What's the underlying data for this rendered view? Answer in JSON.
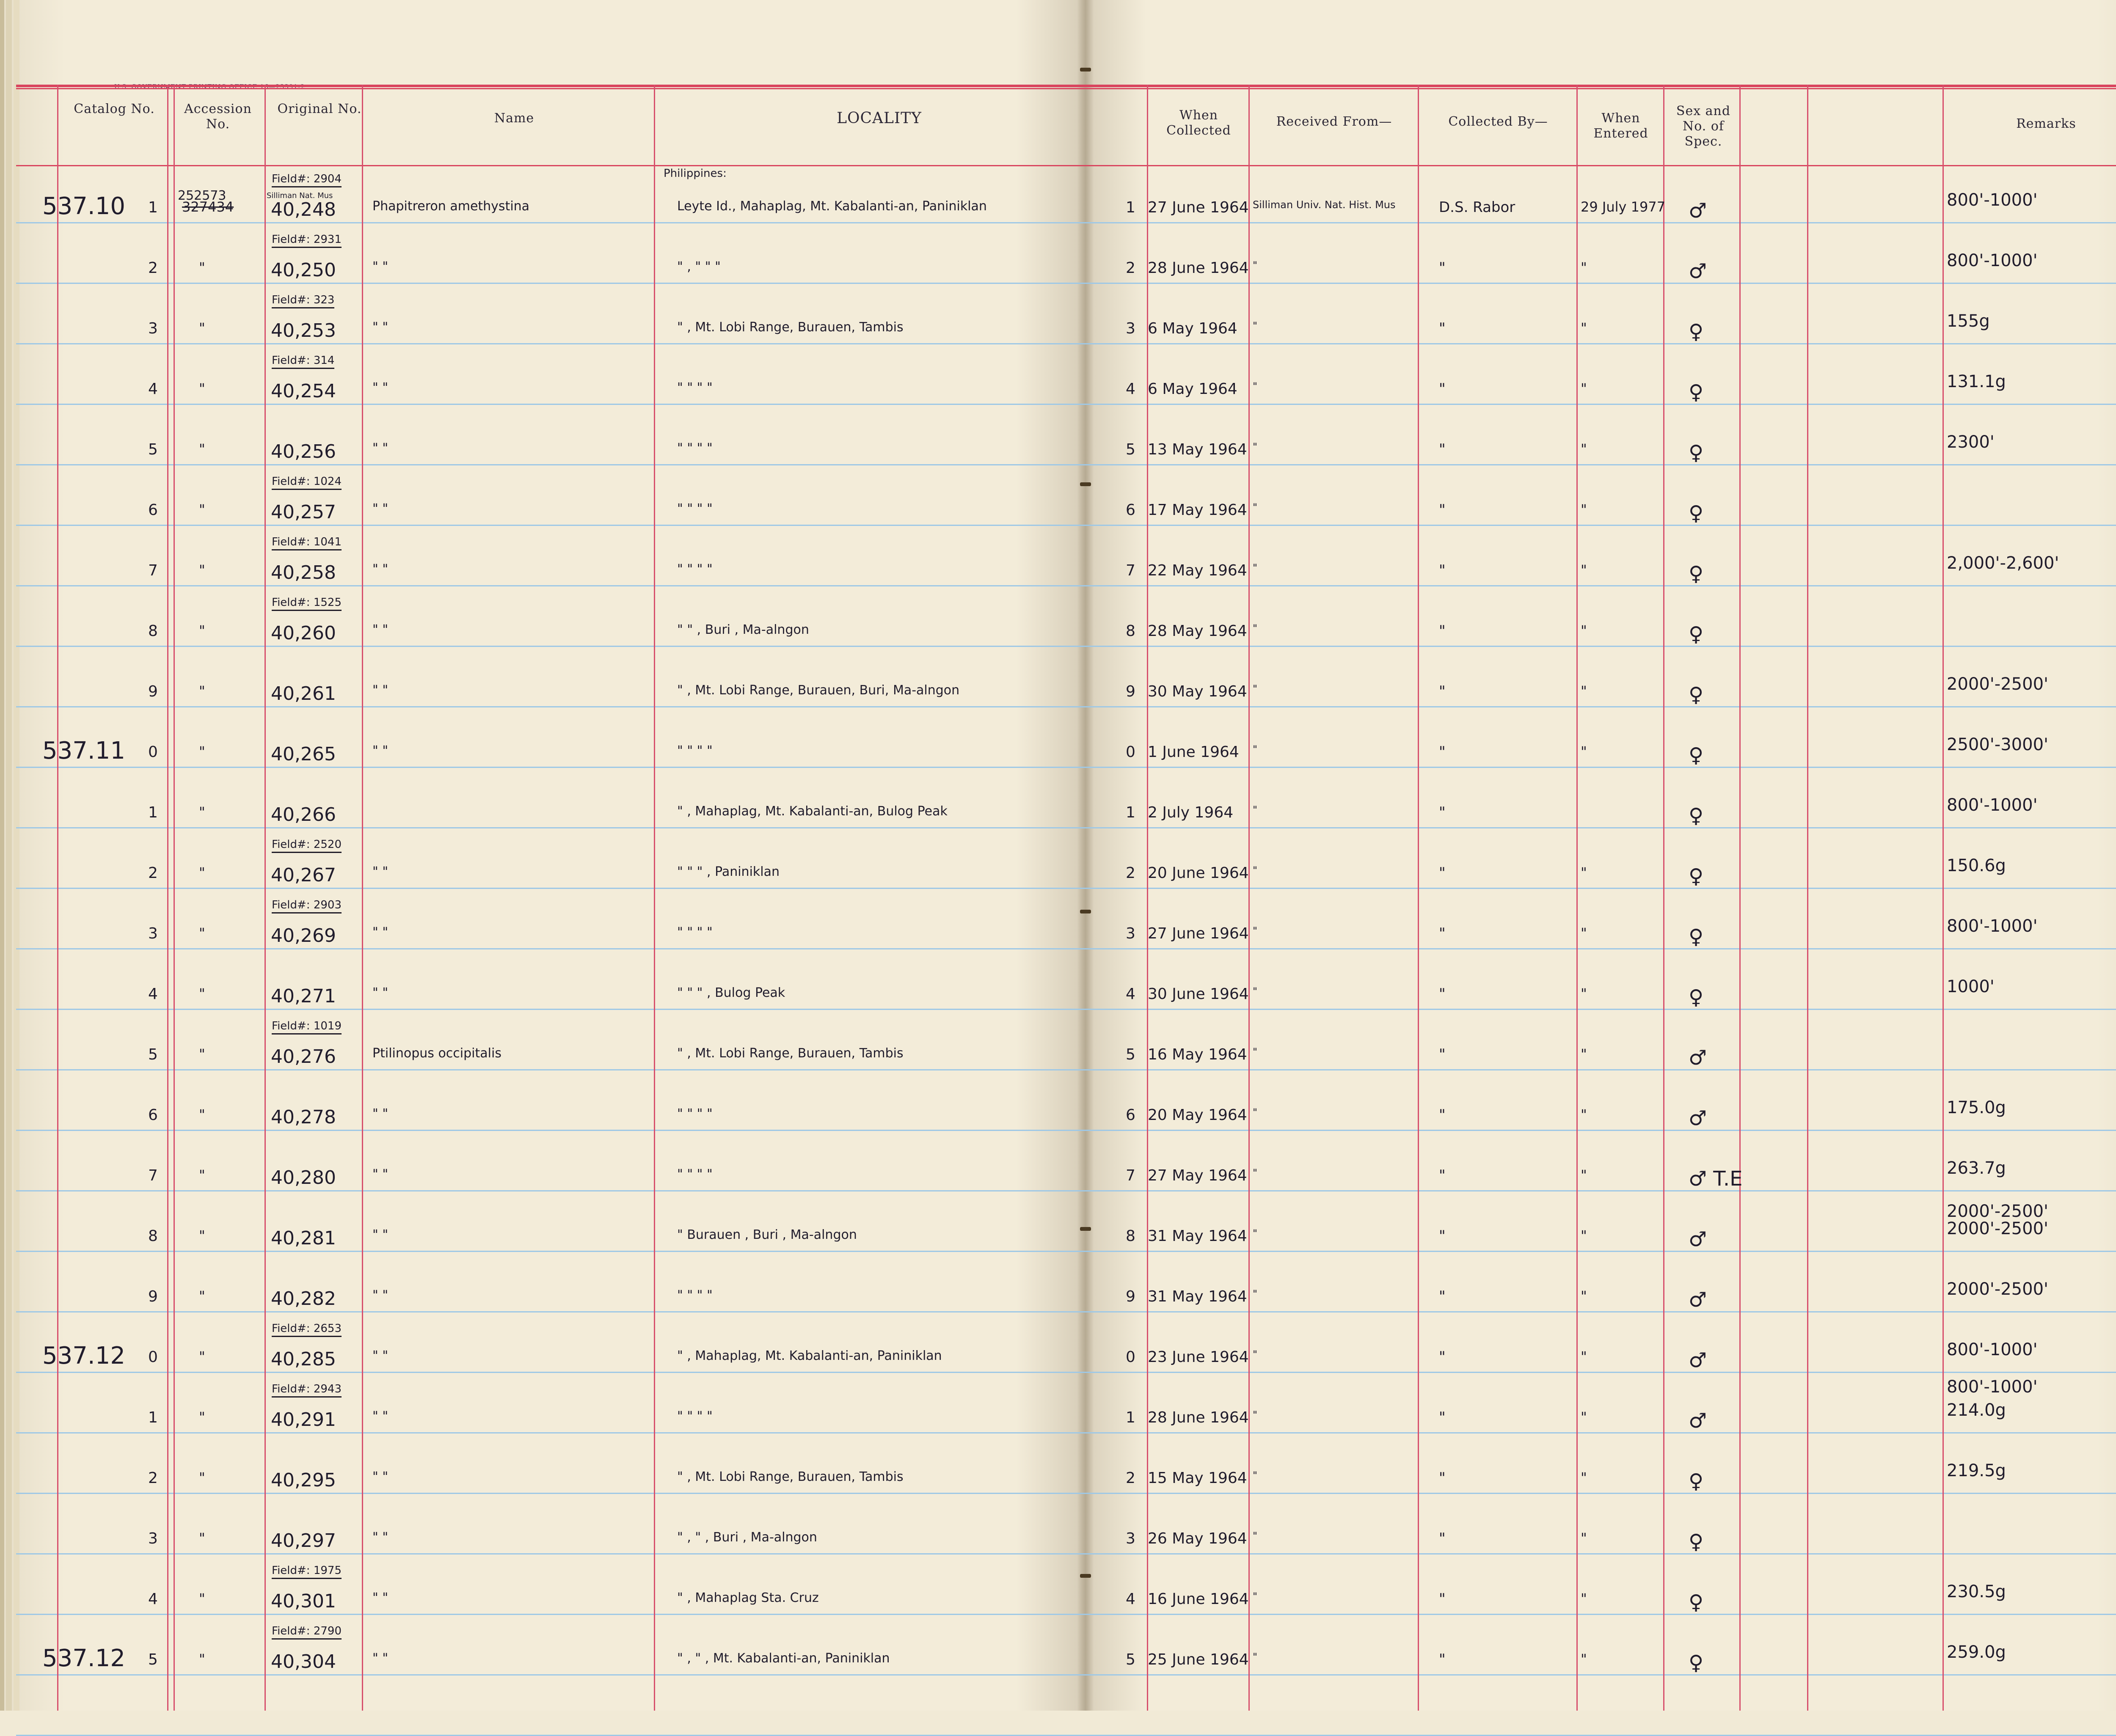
{
  "header": {
    "printer_line": "U.S. GOVERNMENT PRINTING OFFICE 16—23391-2",
    "catalog_no": "Catalog No.",
    "accession_no": "Accession No.",
    "original_no": "Original No.",
    "name": "Name",
    "locality": "LOCALITY",
    "when_collected": "When Collected",
    "received_from": "Received From—",
    "collected_by": "Collected By—",
    "when_entered": "When Entered",
    "sex_and_no": "Sex and No. of Spec.",
    "remarks": "Remarks"
  },
  "locality_heading": "Philippines:",
  "rows": [
    {
      "catalog_prefix": "537.10",
      "digit": "1",
      "accession_top": "252573",
      "accession": "327434",
      "field": "Field#: 2904",
      "field_sub": "Silliman Nat. Mus",
      "original": "40,248",
      "name": "Phapitreron amethystina",
      "locality": "Leyte Id., Mahaplag, Mt. Kabalanti-an, Paniniklan",
      "right_digit": "1",
      "date": "27 June 1964",
      "received": "Silliman Univ. Nat. Hist. Mus",
      "collector": "D.S. Rabor",
      "entered": "29 July 1977",
      "sex": "♂",
      "remarks": "800'-1000'"
    },
    {
      "catalog_prefix": "",
      "digit": "2",
      "accession": "\"",
      "field": "Field#: 2931",
      "original": "40,250",
      "name": "\"        \"",
      "locality": "\"   ,    \"         \"          \"",
      "right_digit": "2",
      "date": "28 June 1964",
      "received": "\"",
      "collector": "\"",
      "entered": "\"",
      "sex": "♂",
      "remarks": "800'-1000'"
    },
    {
      "catalog_prefix": "",
      "digit": "3",
      "accession": "\"",
      "field": "Field#: 323",
      "original": "40,253",
      "name": "\"        \"",
      "locality": "\" , Mt. Lobi Range, Burauen, Tambis",
      "right_digit": "3",
      "date": "6 May 1964",
      "received": "\"",
      "collector": "\"",
      "entered": "\"",
      "sex": "♀",
      "remarks": "155g"
    },
    {
      "catalog_prefix": "",
      "digit": "4",
      "accession": "\"",
      "field": "Field#: 314",
      "original": "40,254",
      "name": "\"        \"",
      "locality": "\"        \"        \"        \"",
      "right_digit": "4",
      "date": "6 May 1964",
      "received": "\"",
      "collector": "\"",
      "entered": "\"",
      "sex": "♀",
      "remarks": "131.1g"
    },
    {
      "catalog_prefix": "",
      "digit": "5",
      "accession": "\"",
      "field": "",
      "original": "40,256",
      "name": "\"        \"",
      "locality": "\"        \"        \"        \"",
      "right_digit": "5",
      "date": "13 May 1964",
      "received": "\"",
      "collector": "\"",
      "entered": "\"",
      "sex": "♀",
      "remarks": "2300'"
    },
    {
      "catalog_prefix": "",
      "digit": "6",
      "accession": "\"",
      "field": "Field#: 1024",
      "original": "40,257",
      "name": "\"        \"",
      "locality": "\"        \"        \"        \"",
      "right_digit": "6",
      "date": "17 May 1964",
      "received": "\"",
      "collector": "\"",
      "entered": "\"",
      "sex": "♀",
      "remarks": ""
    },
    {
      "catalog_prefix": "",
      "digit": "7",
      "accession": "\"",
      "field": "Field#: 1041",
      "original": "40,258",
      "name": "\"        \"",
      "locality": "\"        \"        \"        \"",
      "right_digit": "7",
      "date": "22 May 1964",
      "received": "\"",
      "collector": "\"",
      "entered": "\"",
      "sex": "♀",
      "remarks": "2,000'-2,600'"
    },
    {
      "catalog_prefix": "",
      "digit": "8",
      "accession": "\"",
      "field": "Field#: 1525",
      "original": "40,260",
      "name": "\"        \"",
      "locality": "\"        \"      , Buri , Ma-alngon",
      "right_digit": "8",
      "date": "28 May 1964",
      "received": "\"",
      "collector": "\"",
      "entered": "\"",
      "sex": "♀",
      "remarks": ""
    },
    {
      "catalog_prefix": "",
      "digit": "9",
      "accession": "\"",
      "field": "",
      "original": "40,261",
      "name": "\"        \"",
      "locality": "\" , Mt. Lobi Range, Burauen, Buri, Ma-alngon",
      "right_digit": "9",
      "date": "30 May 1964",
      "received": "\"",
      "collector": "\"",
      "entered": "\"",
      "sex": "♀",
      "remarks": "2000'-2500'"
    },
    {
      "catalog_prefix": "537.11",
      "digit": "0",
      "accession": "\"",
      "field": "",
      "original": "40,265",
      "name": "\"        \"",
      "locality": "\"        \"        \"        \"",
      "right_digit": "0",
      "date": "1 June 1964",
      "received": "\"",
      "collector": "\"",
      "entered": "\"",
      "sex": "♀",
      "remarks": "2500'-3000'"
    },
    {
      "catalog_prefix": "",
      "digit": "1",
      "accession": "\"",
      "field": "",
      "original": "40,266",
      "name": "",
      "locality": "\" , Mahaplag, Mt. Kabalanti-an, Bulog Peak",
      "right_digit": "1",
      "date": "2 July 1964",
      "received": "\"",
      "collector": "\"",
      "entered": "",
      "sex": "♀",
      "remarks": "800'-1000'"
    },
    {
      "catalog_prefix": "",
      "digit": "2",
      "accession": "\"",
      "field": "Field#: 2520",
      "original": "40,267",
      "name": "\"        \"",
      "locality": "\"        \"        \"        , Paniniklan",
      "right_digit": "2",
      "date": "20 June 1964",
      "received": "\"",
      "collector": "\"",
      "entered": "\"",
      "sex": "♀",
      "remarks": "150.6g"
    },
    {
      "catalog_prefix": "",
      "digit": "3",
      "accession": "\"",
      "field": "Field#: 2903",
      "original": "40,269",
      "name": "\"        \"",
      "locality": "\"        \"        \"        \"",
      "right_digit": "3",
      "date": "27 June 1964",
      "received": "\"",
      "collector": "\"",
      "entered": "\"",
      "sex": "♀",
      "remarks": "800'-1000'"
    },
    {
      "catalog_prefix": "",
      "digit": "4",
      "accession": "\"",
      "field": "",
      "original": "40,271",
      "name": "\"        \"",
      "locality": "\"        \"        \"      , Bulog Peak",
      "right_digit": "4",
      "date": "30 June 1964",
      "received": "\"",
      "collector": "\"",
      "entered": "\"",
      "sex": "♀",
      "remarks": "1000'"
    },
    {
      "catalog_prefix": "",
      "digit": "5",
      "accession": "\"",
      "field": "Field#: 1019",
      "original": "40,276",
      "name": "Ptilinopus occipitalis",
      "locality": "\" , Mt. Lobi Range, Burauen, Tambis",
      "right_digit": "5",
      "date": "16 May 1964",
      "received": "\"",
      "collector": "\"",
      "entered": "\"",
      "sex": "♂",
      "remarks": ""
    },
    {
      "catalog_prefix": "",
      "digit": "6",
      "accession": "\"",
      "field": "",
      "original": "40,278",
      "name": "\"        \"",
      "locality": "\"        \"        \"        \"",
      "right_digit": "6",
      "date": "20 May 1964",
      "received": "\"",
      "collector": "\"",
      "entered": "\"",
      "sex": "♂",
      "remarks": "175.0g"
    },
    {
      "catalog_prefix": "",
      "digit": "7",
      "accession": "\"",
      "field": "",
      "original": "40,280",
      "name": "\"        \"",
      "locality": "\"        \"        \"        \"",
      "right_digit": "7",
      "date": "27 May 1964",
      "received": "\"",
      "collector": "\"",
      "entered": "\"",
      "sex": "♂ T.E",
      "remarks": "263.7g"
    },
    {
      "catalog_prefix": "",
      "digit": "8",
      "accession": "\"",
      "field": "",
      "original": "40,281",
      "name": "\"        \"",
      "locality": "\"      Burauen , Buri , Ma-alngon",
      "right_digit": "8",
      "date": "31 May 1964",
      "received": "\"",
      "collector": "\"",
      "entered": "\"",
      "sex": "♂",
      "remarks": "2000'-2500'"
    },
    {
      "catalog_prefix": "",
      "digit": "9",
      "accession": "\"",
      "field": "",
      "original": "40,282",
      "name": "\"        \"",
      "locality": "\"        \"        \"        \"",
      "right_digit": "9",
      "date": "31 May 1964",
      "received": "\"",
      "collector": "\"",
      "entered": "\"",
      "sex": "♂",
      "remarks": "2000'-2500'"
    },
    {
      "catalog_prefix": "537.12",
      "digit": "0",
      "accession": "\"",
      "field": "Field#: 2653",
      "original": "40,285",
      "name": "\"        \"",
      "locality": "\" , Mahaplag, Mt. Kabalanti-an, Paniniklan",
      "right_digit": "0",
      "date": "23 June 1964",
      "received": "\"",
      "collector": "\"",
      "entered": "\"",
      "sex": "♂",
      "remarks": "800'-1000'"
    },
    {
      "catalog_prefix": "",
      "digit": "1",
      "accession": "\"",
      "field": "Field#: 2943",
      "original": "40,291",
      "name": "\"        \"",
      "locality": "\"        \"        \"        \"",
      "right_digit": "1",
      "date": "28 June 1964",
      "received": "\"",
      "collector": "\"",
      "entered": "\"",
      "sex": "♂",
      "remarks": "214.0g"
    },
    {
      "catalog_prefix": "",
      "digit": "2",
      "accession": "\"",
      "field": "",
      "original": "40,295",
      "name": "\"        \"",
      "locality": "\" , Mt. Lobi Range, Burauen, Tambis",
      "right_digit": "2",
      "date": "15 May 1964",
      "received": "\"",
      "collector": "\"",
      "entered": "\"",
      "sex": "♀",
      "remarks": "219.5g"
    },
    {
      "catalog_prefix": "",
      "digit": "3",
      "accession": "\"",
      "field": "",
      "original": "40,297",
      "name": "\"        \"",
      "locality": "\"  ,    \"        , Buri , Ma-alngon",
      "right_digit": "3",
      "date": "26 May 1964",
      "received": "\"",
      "collector": "\"",
      "entered": "\"",
      "sex": "♀",
      "remarks": ""
    },
    {
      "catalog_prefix": "",
      "digit": "4",
      "accession": "\"",
      "field": "Field#: 1975",
      "original": "40,301",
      "name": "\"        \"",
      "locality": "\" , Mahaplag  Sta. Cruz",
      "right_digit": "4",
      "date": "16 June 1964",
      "received": "\"",
      "collector": "\"",
      "entered": "\"",
      "sex": "♀",
      "remarks": "230.5g"
    },
    {
      "catalog_prefix": "537.12",
      "digit": "5",
      "accession": "\"",
      "field": "Field#: 2790",
      "original": "40,304",
      "name": "\"        \"",
      "locality": "\"  ,   \"     , Mt. Kabalanti-an, Paniniklan",
      "right_digit": "5",
      "date": "25 June 1964",
      "received": "\"",
      "collector": "\"",
      "entered": "\"",
      "sex": "♀",
      "remarks": "259.0g"
    }
  ],
  "extra_remarks": [
    "2000'-2500'",
    "800'-1000'"
  ]
}
